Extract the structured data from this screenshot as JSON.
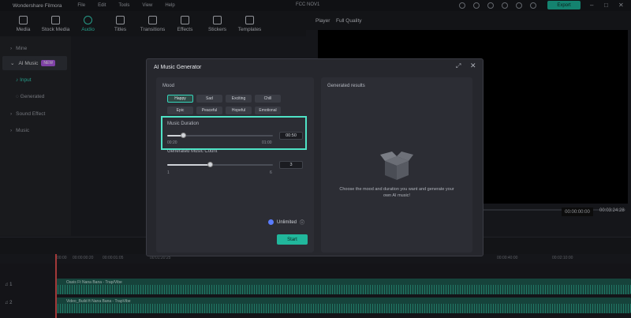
{
  "titlebar": {
    "app_name": "Wondershare Filmora",
    "menu": [
      "File",
      "Edit",
      "Tools",
      "View",
      "Help"
    ],
    "project_name": "FCC NOV1",
    "export_label": "Export"
  },
  "toolbar": {
    "tools": [
      {
        "label": "Media",
        "icon": "media-icon"
      },
      {
        "label": "Stock Media",
        "icon": "stock-media-icon"
      },
      {
        "label": "Audio",
        "icon": "audio-icon",
        "active": true
      },
      {
        "label": "Titles",
        "icon": "titles-icon"
      },
      {
        "label": "Transitions",
        "icon": "transitions-icon"
      },
      {
        "label": "Effects",
        "icon": "effects-icon"
      },
      {
        "label": "Stickers",
        "icon": "stickers-icon"
      },
      {
        "label": "Templates",
        "icon": "templates-icon"
      }
    ]
  },
  "player": {
    "label": "Player",
    "quality": "Full Quality",
    "time_current": "00:00:00:00",
    "time_total": "00:03:24:28"
  },
  "sidebar": {
    "items": [
      {
        "label": "Mine"
      },
      {
        "label": "AI Music",
        "badge": "NEW"
      },
      {
        "label": "Sound Effect"
      },
      {
        "label": "Music"
      }
    ],
    "sub_items": [
      "Input",
      "Generated"
    ]
  },
  "timeline": {
    "ruler": [
      "00:00",
      "00:00:00:20",
      "00:00:01:05",
      "00:01:20:25",
      "00:00:40:00",
      "00:02:10:00"
    ],
    "tracks": [
      {
        "head": "1",
        "clip_name": "Oasis Ft Nana Bana - Trap/Vibe"
      },
      {
        "head": "2",
        "clip_name": "Video_Build ft Nana Bana - TrapVibe"
      }
    ]
  },
  "dialog": {
    "title": "AI Music Generator",
    "mood": {
      "label": "Mood",
      "options": [
        "Happy",
        "Sad",
        "Exciting",
        "Chill",
        "Epic",
        "Peaceful",
        "Hopeful",
        "Emotional"
      ],
      "selected": "Happy"
    },
    "duration": {
      "label": "Music Duration",
      "value": "00:50",
      "min_label": "00:20",
      "max_label": "01:00",
      "level": 0.15
    },
    "count": {
      "label": "Generated Music Count",
      "value": "3",
      "min_label": "1",
      "max_label": "6",
      "level": 0.4
    },
    "unlimited_label": "Unlimited",
    "start_label": "Start",
    "results": {
      "title": "Generated results",
      "hint": "Choose the mood and duration you want and generate your own AI music!"
    }
  },
  "colors": {
    "accent": "#35d6bb",
    "highlight": "#4fe3c6",
    "export": "#1db59a"
  }
}
